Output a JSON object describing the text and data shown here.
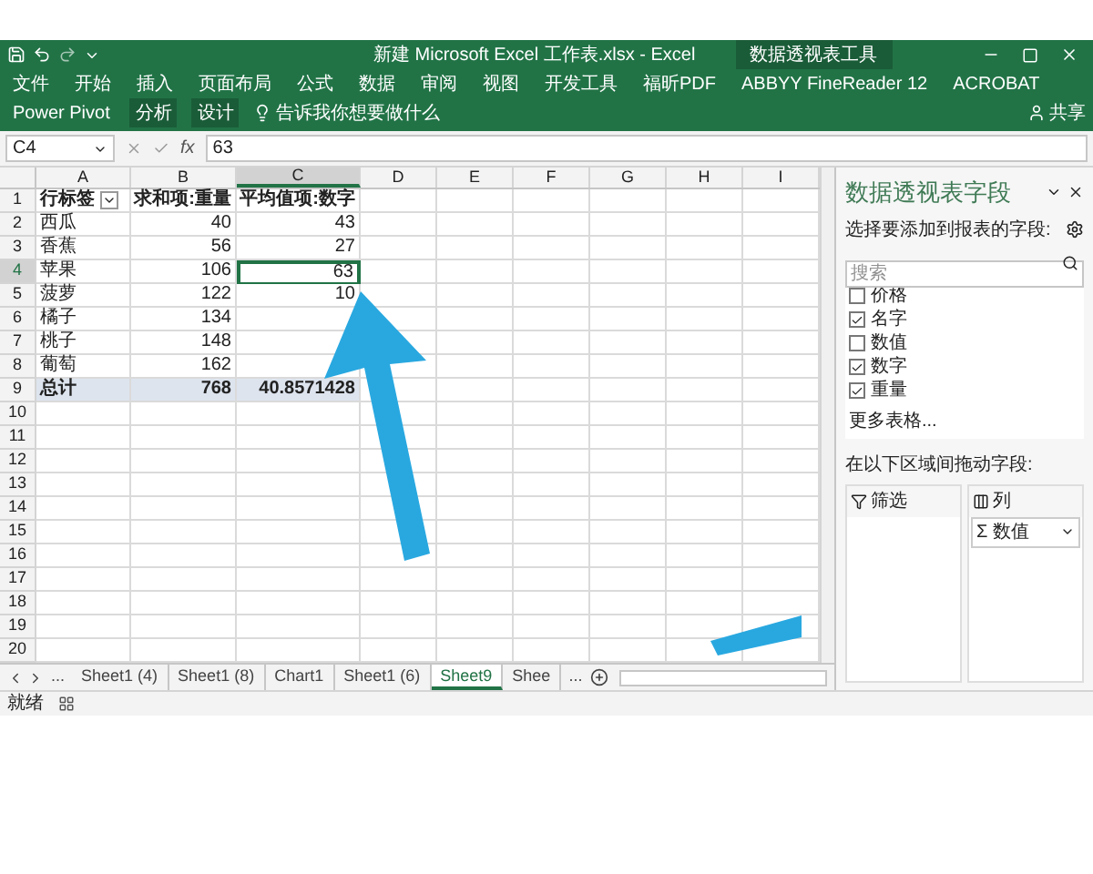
{
  "title_bar": {
    "title": "新建 Microsoft Excel 工作表.xlsx - Excel",
    "context_label": "数据透视表工具"
  },
  "ribbon_tabs": [
    {
      "label": "文件",
      "kind": "normal"
    },
    {
      "label": "开始",
      "kind": "normal"
    },
    {
      "label": "插入",
      "kind": "normal"
    },
    {
      "label": "页面布局",
      "kind": "normal"
    },
    {
      "label": "公式",
      "kind": "normal"
    },
    {
      "label": "数据",
      "kind": "normal"
    },
    {
      "label": "审阅",
      "kind": "normal"
    },
    {
      "label": "视图",
      "kind": "normal"
    },
    {
      "label": "开发工具",
      "kind": "normal"
    },
    {
      "label": "福昕PDF",
      "kind": "normal"
    },
    {
      "label": "ABBYY FineReader 12",
      "kind": "normal"
    },
    {
      "label": "ACROBAT",
      "kind": "normal"
    },
    {
      "label": "Power Pivot",
      "kind": "normal"
    },
    {
      "label": "分析",
      "kind": "context"
    },
    {
      "label": "设计",
      "kind": "context"
    }
  ],
  "tell_me": "告诉我你想要做什么",
  "share": "共享",
  "formula_bar": {
    "name_box": "C4",
    "function_label": "fx",
    "formula": "63"
  },
  "columns": [
    {
      "label": "A",
      "selected": false
    },
    {
      "label": "B",
      "selected": false
    },
    {
      "label": "C",
      "selected": true
    },
    {
      "label": "D",
      "selected": false
    },
    {
      "label": "E",
      "selected": false
    },
    {
      "label": "F",
      "selected": false
    },
    {
      "label": "G",
      "selected": false
    },
    {
      "label": "H",
      "selected": false
    },
    {
      "label": "I",
      "selected": false
    }
  ],
  "rows": [
    {
      "number": "1",
      "kind": "header",
      "selected": false,
      "cells": [
        {
          "text": "行标签",
          "selected": false
        },
        {
          "text": "求和项:重量",
          "selected": false
        },
        {
          "text": "平均值项:数字",
          "selected": false
        }
      ]
    },
    {
      "number": "2",
      "kind": "data",
      "selected": false,
      "cells": [
        {
          "text": "西瓜",
          "selected": false
        },
        {
          "text": "40",
          "selected": false
        },
        {
          "text": "43",
          "selected": false
        }
      ]
    },
    {
      "number": "3",
      "kind": "data",
      "selected": false,
      "cells": [
        {
          "text": "香蕉",
          "selected": false
        },
        {
          "text": "56",
          "selected": false
        },
        {
          "text": "27",
          "selected": false
        }
      ]
    },
    {
      "number": "4",
      "kind": "data",
      "selected": true,
      "cells": [
        {
          "text": "苹果",
          "selected": false
        },
        {
          "text": "106",
          "selected": false
        },
        {
          "text": "63",
          "selected": true
        }
      ]
    },
    {
      "number": "5",
      "kind": "data",
      "selected": false,
      "cells": [
        {
          "text": "菠萝",
          "selected": false
        },
        {
          "text": "122",
          "selected": false
        },
        {
          "text": "10",
          "selected": false
        }
      ]
    },
    {
      "number": "6",
      "kind": "data",
      "selected": false,
      "cells": [
        {
          "text": "橘子",
          "selected": false
        },
        {
          "text": "134",
          "selected": false
        }
      ]
    },
    {
      "number": "7",
      "kind": "data",
      "selected": false,
      "cells": [
        {
          "text": "桃子",
          "selected": false
        },
        {
          "text": "148",
          "selected": false
        }
      ]
    },
    {
      "number": "8",
      "kind": "data",
      "selected": false,
      "cells": [
        {
          "text": "葡萄",
          "selected": false
        },
        {
          "text": "162",
          "selected": false
        }
      ]
    },
    {
      "number": "9",
      "kind": "total",
      "selected": false,
      "cells": [
        {
          "text": "总计",
          "selected": false
        },
        {
          "text": "768",
          "selected": false
        },
        {
          "text": "40.8571428",
          "selected": false
        }
      ]
    },
    {
      "number": "10",
      "kind": "empty",
      "selected": false
    },
    {
      "number": "11",
      "kind": "empty",
      "selected": false
    },
    {
      "number": "12",
      "kind": "empty",
      "selected": false
    },
    {
      "number": "13",
      "kind": "empty",
      "selected": false
    },
    {
      "number": "14",
      "kind": "empty",
      "selected": false
    },
    {
      "number": "15",
      "kind": "empty",
      "selected": false
    },
    {
      "number": "16",
      "kind": "empty",
      "selected": false
    },
    {
      "number": "17",
      "kind": "empty",
      "selected": false
    },
    {
      "number": "18",
      "kind": "empty",
      "selected": false
    },
    {
      "number": "19",
      "kind": "empty",
      "selected": false
    },
    {
      "number": "20",
      "kind": "empty",
      "selected": false
    }
  ],
  "sheet_tabs": {
    "more_left": "...",
    "tabs": [
      {
        "label": "Sheet1 (4)",
        "selected": false
      },
      {
        "label": "Sheet1 (8)",
        "selected": false
      },
      {
        "label": "Chart1",
        "selected": false
      },
      {
        "label": "Sheet1 (6)",
        "selected": false
      },
      {
        "label": "Sheet9",
        "selected": true
      },
      {
        "label": "Shee",
        "selected": false
      }
    ],
    "more_right": "..."
  },
  "status_bar": {
    "text": "就绪"
  },
  "pivot_pane": {
    "title": "数据透视表字段",
    "subtitle": "选择要添加到报表的字段:",
    "search": {
      "placeholder": "搜索"
    },
    "fields": [
      {
        "label": "价格",
        "checked": false
      },
      {
        "label": "名字",
        "checked": true
      },
      {
        "label": "数值",
        "checked": false
      },
      {
        "label": "数字",
        "checked": true
      },
      {
        "label": "重量",
        "checked": true
      }
    ],
    "more_tables": "更多表格...",
    "areas_hint": "在以下区域间拖动字段:",
    "areas": [
      {
        "label": "筛选",
        "kind": "filter"
      },
      {
        "label": "列",
        "kind": "columns",
        "items": [
          "Σ 数值"
        ]
      }
    ]
  }
}
